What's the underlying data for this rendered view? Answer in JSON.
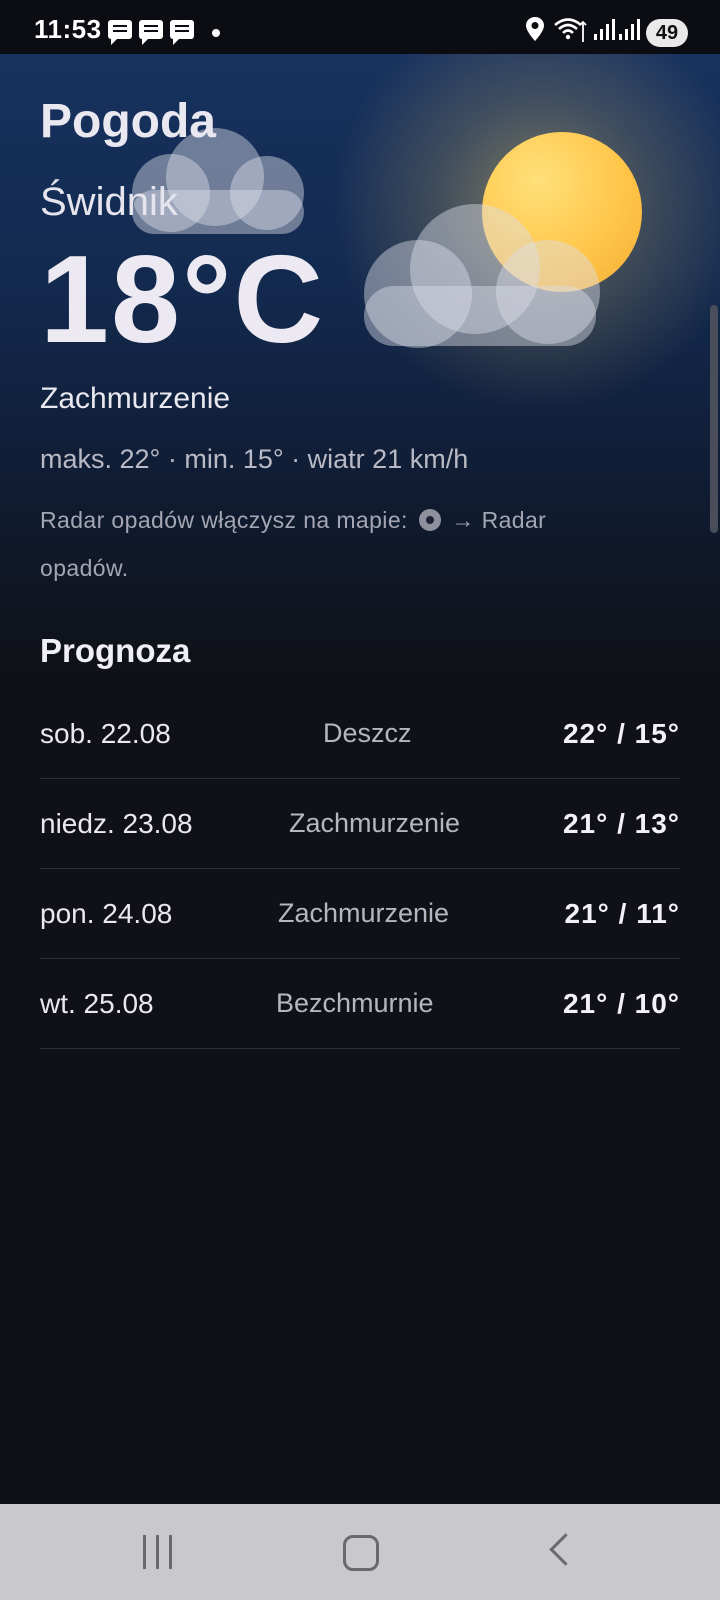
{
  "status_bar": {
    "time": "11:53",
    "battery": "49",
    "icons": [
      "message-icon",
      "message-icon",
      "message-icon",
      "notification-dot",
      "location-icon",
      "wifi-icon",
      "signal-icon",
      "signal-icon"
    ]
  },
  "weather": {
    "app_title": "Pogoda",
    "city": "Świdnik",
    "temperature": "18°C",
    "condition": "Zachmurzenie",
    "details": "maks. 22° · min. 15° · wiatr 21 km/h",
    "radar_hint_prefix": "Radar opadów włączysz na mapie:",
    "radar_hint_suffix": "→ Radar opadów.",
    "hero_icon": "sun-behind-cloud-icon"
  },
  "forecast": {
    "title": "Prognoza",
    "rows": [
      {
        "date": "sob. 22.08",
        "condition": "Deszcz",
        "temps": "22° / 15°"
      },
      {
        "date": "niedz. 23.08",
        "condition": "Zachmurzenie",
        "temps": "21° / 13°"
      },
      {
        "date": "pon. 24.08",
        "condition": "Zachmurzenie",
        "temps": "21° / 11°"
      },
      {
        "date": "wt. 25.08",
        "condition": "Bezchmurnie",
        "temps": "21° / 10°"
      }
    ]
  },
  "nav_bar": {
    "icons": [
      "recents-icon",
      "home-icon",
      "back-icon"
    ]
  },
  "colors": {
    "background": "#0f1116",
    "hero_top": "#17325f",
    "sun": "#ffc64a",
    "nav_bar": "#c9c9cb"
  }
}
